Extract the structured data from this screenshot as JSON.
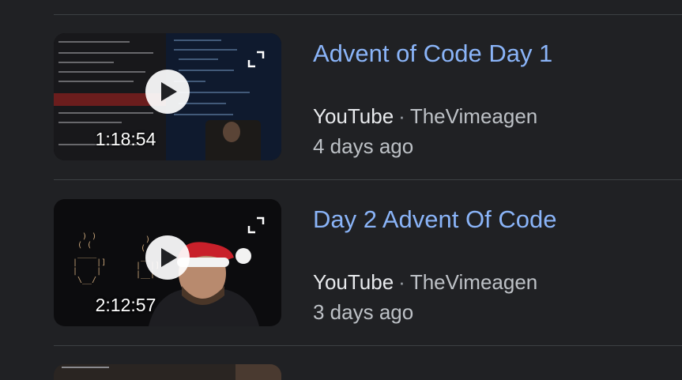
{
  "results": [
    {
      "title": "Advent of Code Day 1",
      "source": "YouTube",
      "separator": "·",
      "channel": "TheVimeagen",
      "age": "4 days ago",
      "duration": "1:18:54",
      "thumbnail_icons": [
        "play-icon",
        "expand-icon"
      ]
    },
    {
      "title": "Day 2 Advent Of Code",
      "source": "YouTube",
      "separator": "·",
      "channel": "TheVimeagen",
      "age": "3 days ago",
      "duration": "2:12:57",
      "thumbnail_icons": [
        "play-icon",
        "expand-icon"
      ]
    }
  ],
  "colors": {
    "background": "#202124",
    "title_link": "#8ab4f8",
    "meta_text": "#bdc1c6",
    "divider": "#3c4043"
  }
}
